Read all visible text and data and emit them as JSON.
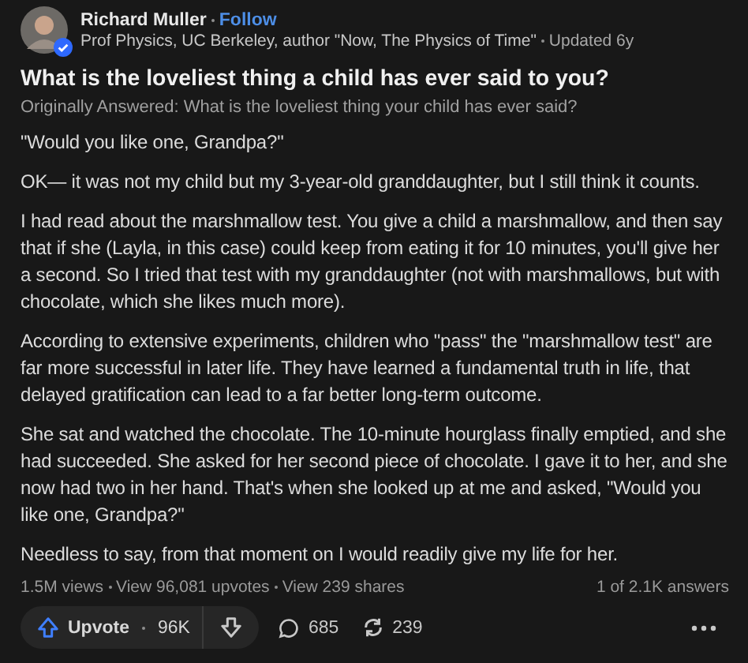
{
  "author": {
    "name": "Richard Muller",
    "follow": "Follow",
    "credentials": "Prof Physics, UC Berkeley, author \"Now, The Physics of Time\"",
    "updated": "Updated 6y",
    "verified": true
  },
  "question": "What is the loveliest thing a child has ever said to you?",
  "original_question": "Originally Answered: What is the loveliest thing your child has ever said?",
  "paragraphs": [
    "\"Would you like one, Grandpa?\"",
    "OK— it was not my child but my 3-year-old granddaughter, but I still think it counts.",
    "I had read about the marshmallow test. You give a child a marshmallow, and then say that if she (Layla, in this case) could keep from eating it for 10 minutes, you'll give her a second. So I tried that test with my granddaughter (not with marshmallows, but with chocolate, which she likes much more).",
    "According to extensive experiments, children who \"pass\" the \"marshmallow test\" are far more successful in later life. They have learned a fundamental truth in life, that delayed gratification can lead to a far better long-term outcome.",
    "She sat and watched the chocolate. The 10-minute hourglass finally emptied, and she had succeeded. She asked for her second piece of chocolate. I gave it to her, and she now had two in her hand. That's when she looked up at me and asked, \"Would you like one, Grandpa?\"",
    "Needless to say, from that moment on I would readily give my life for her."
  ],
  "stats": [
    "1.5M views",
    "View 96,081 upvotes",
    "View 239 shares"
  ],
  "answer_position": "1 of 2.1K answers",
  "actions": {
    "upvote": "Upvote",
    "upvote_count": "96K",
    "comments": "685",
    "shares": "239"
  }
}
